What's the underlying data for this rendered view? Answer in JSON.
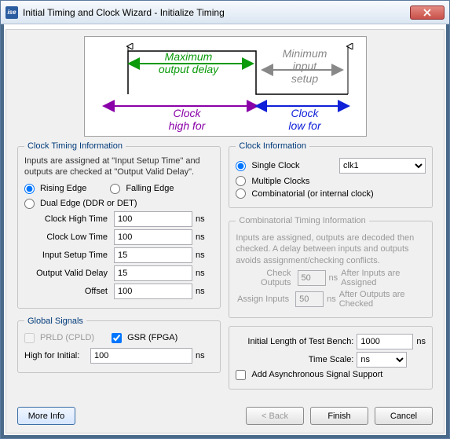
{
  "window": {
    "title": "Initial Timing and Clock Wizard - Initialize Timing",
    "icon_label": "ise"
  },
  "diagram": {
    "max_output_delay_l1": "Maximum",
    "max_output_delay_l2": "output delay",
    "min_input_setup_l1": "Minimum",
    "min_input_setup_l2": "input",
    "min_input_setup_l3": "setup",
    "clock_high_l1": "Clock",
    "clock_high_l2": "high for",
    "clock_low_l1": "Clock",
    "clock_low_l2": "low for"
  },
  "clock_timing": {
    "legend": "Clock Timing Information",
    "help": "Inputs are assigned at \"Input Setup Time\" and outputs are checked at \"Output Valid Delay\".",
    "rising_edge": "Rising Edge",
    "falling_edge": "Falling Edge",
    "dual_edge": "Dual Edge (DDR or DET)",
    "rows": {
      "clock_high_time": {
        "label": "Clock High Time",
        "value": "100",
        "unit": "ns"
      },
      "clock_low_time": {
        "label": "Clock Low Time",
        "value": "100",
        "unit": "ns"
      },
      "input_setup_time": {
        "label": "Input Setup Time",
        "value": "15",
        "unit": "ns"
      },
      "output_valid_delay": {
        "label": "Output Valid Delay",
        "value": "15",
        "unit": "ns"
      },
      "offset": {
        "label": "Offset",
        "value": "100",
        "unit": "ns"
      }
    }
  },
  "global_signals": {
    "legend": "Global Signals",
    "prld": "PRLD (CPLD)",
    "gsr": "GSR (FPGA)",
    "high_for_initial_label": "High for Initial:",
    "high_for_initial_value": "100",
    "unit": "ns"
  },
  "clock_info": {
    "legend": "Clock Information",
    "single_clock": "Single Clock",
    "single_clock_select": "clk1",
    "multiple_clocks": "Multiple Clocks",
    "combinatorial": "Combinatorial (or internal clock)"
  },
  "comb_info": {
    "legend": "Combinatorial Timing Information",
    "help": "Inputs are assigned, outputs are decoded then checked.  A delay between inputs and outputs avoids assignment/checking conflicts.",
    "check_outputs_label": "Check Outputs",
    "check_outputs_value": "50",
    "check_outputs_after": "After Inputs are Assigned",
    "assign_inputs_label": "Assign Inputs",
    "assign_inputs_value": "50",
    "assign_inputs_after": "After Outputs are Checked",
    "unit": "ns"
  },
  "testbench": {
    "initial_length_label": "Initial Length of Test Bench:",
    "initial_length_value": "1000",
    "initial_length_unit": "ns",
    "time_scale_label": "Time Scale:",
    "time_scale_value": "ns",
    "add_async_label": "Add Asynchronous Signal Support"
  },
  "footer": {
    "more_info": "More Info",
    "back": "< Back",
    "finish": "Finish",
    "cancel": "Cancel"
  }
}
